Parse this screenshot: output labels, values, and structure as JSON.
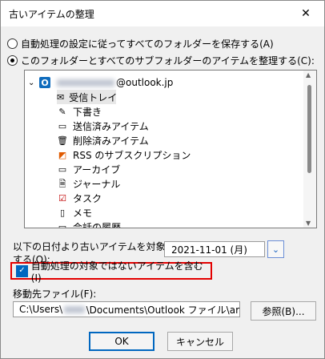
{
  "window": {
    "title": "古いアイテムの整理",
    "close_label": "✕"
  },
  "options": {
    "radio1": "自動処理の設定に従ってすべてのフォルダーを保存する(A)",
    "radio2": "このフォルダーとすべてのサブフォルダーのアイテムを整理する(C):"
  },
  "tree": {
    "account": "@outlook.jp",
    "items": [
      "受信トレイ",
      "下書き",
      "送信済みアイテム",
      "削除済みアイテム",
      "RSS のサブスクリプション",
      "アーカイブ",
      "ジャーナル",
      "タスク",
      "メモ",
      "会話の履歴"
    ]
  },
  "date_section": {
    "label_line1": "以下の日付より古いアイテムを対象と",
    "label_line2": "する(O):",
    "value": "2021-11-01 (月)"
  },
  "checkbox": {
    "label": "自動処理の対象ではないアイテムを含む(I)",
    "checked": true
  },
  "destination": {
    "label": "移動先ファイル(F):",
    "path_prefix": "C:\\Users\\",
    "path_suffix": "\\Documents\\Outlook ファイル\\ar",
    "browse_label": "参照(B)..."
  },
  "buttons": {
    "ok": "OK",
    "cancel": "キャンセル"
  }
}
